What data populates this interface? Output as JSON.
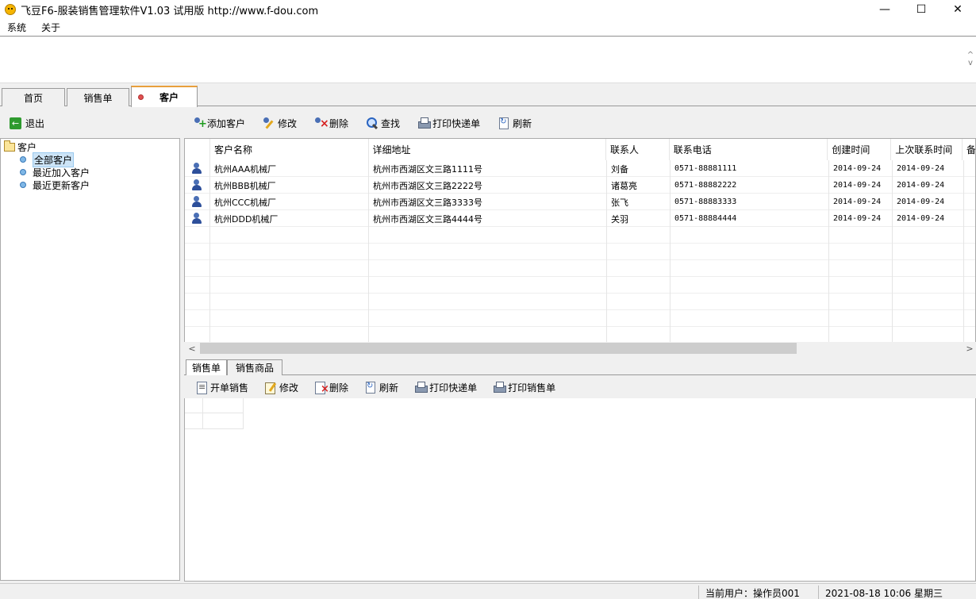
{
  "window": {
    "title": "飞豆F6-服装销售管理软件V1.03 试用版 http://www.f-dou.com",
    "minimize": "—",
    "maximize": "☐",
    "close": "✕"
  },
  "menu": [
    "系统",
    "关于"
  ],
  "tabs": [
    {
      "label": "首页"
    },
    {
      "label": "销售单"
    },
    {
      "label": "客户",
      "active": true
    }
  ],
  "left_toolbar": {
    "exit_label": "退出"
  },
  "toolbar": {
    "add": "添加客户",
    "edit": "修改",
    "delete": "删除",
    "find": "查找",
    "print_express": "打印快递单",
    "refresh": "刷新"
  },
  "tree": {
    "root": "客户",
    "children": [
      "全部客户",
      "最近加入客户",
      "最近更新客户"
    ],
    "selected_index": 0
  },
  "grid": {
    "columns": [
      "客户名称",
      "详细地址",
      "联系人",
      "联系电话",
      "创建时间",
      "上次联系时间",
      "备"
    ],
    "rows": [
      [
        "杭州AAA机械厂",
        "杭州市西湖区文三路1111号",
        "刘备",
        "0571-88881111",
        "2014-09-24",
        "2014-09-24"
      ],
      [
        "杭州BBB机械厂",
        "杭州市西湖区文三路2222号",
        "诸葛亮",
        "0571-88882222",
        "2014-09-24",
        "2014-09-24"
      ],
      [
        "杭州CCC机械厂",
        "杭州市西湖区文三路3333号",
        "张飞",
        "0571-88883333",
        "2014-09-24",
        "2014-09-24"
      ],
      [
        "杭州DDD机械厂",
        "杭州市西湖区文三路4444号",
        "关羽",
        "0571-88884444",
        "2014-09-24",
        "2014-09-24"
      ]
    ]
  },
  "bottom_tabs": [
    "销售单",
    "销售商品"
  ],
  "bottom_toolbar": {
    "new_sale": "开单销售",
    "edit": "修改",
    "delete": "删除",
    "refresh": "刷新",
    "print_express": "打印快递单",
    "print_sale": "打印销售单"
  },
  "status": {
    "current_user": "当前用户：操作员001",
    "datetime": "2021-08-18 10:06 星期三"
  },
  "scroll": {
    "left": "<",
    "right": ">",
    "up": "^",
    "down": "v"
  }
}
